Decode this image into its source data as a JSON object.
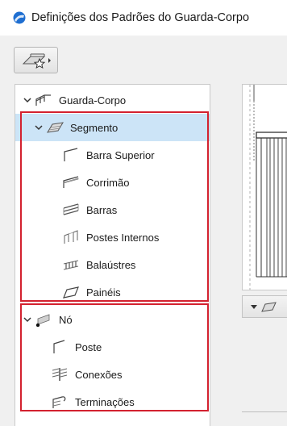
{
  "window": {
    "title": "Definições dos Padrões do Guarda-Corpo",
    "app_icon": "archicad-icon",
    "accent_color": "#1f6fd1"
  },
  "toolbar": {
    "favorites_button_icon": "favorites-star-icon"
  },
  "tree": {
    "root": {
      "label": "Guarda-Corpo",
      "icon": "railing-icon",
      "expanded": true
    },
    "segment": {
      "label": "Segmento",
      "icon": "segment-icon",
      "expanded": true,
      "selected": true,
      "children": [
        {
          "label": "Barra Superior",
          "icon": "top-rail-icon"
        },
        {
          "label": "Corrimão",
          "icon": "handrail-icon"
        },
        {
          "label": "Barras",
          "icon": "rails-icon"
        },
        {
          "label": "Postes Internos",
          "icon": "inner-posts-icon"
        },
        {
          "label": "Balaústres",
          "icon": "balusters-icon"
        },
        {
          "label": "Painéis",
          "icon": "panels-icon"
        }
      ]
    },
    "node": {
      "label": "Nó",
      "icon": "node-icon",
      "expanded": true,
      "children": [
        {
          "label": "Poste",
          "icon": "post-icon"
        },
        {
          "label": "Conexões",
          "icon": "connections-icon"
        },
        {
          "label": "Terminações",
          "icon": "endings-icon"
        }
      ]
    }
  },
  "highlight_color": "#d3212f",
  "selection_color": "#cce4f7"
}
